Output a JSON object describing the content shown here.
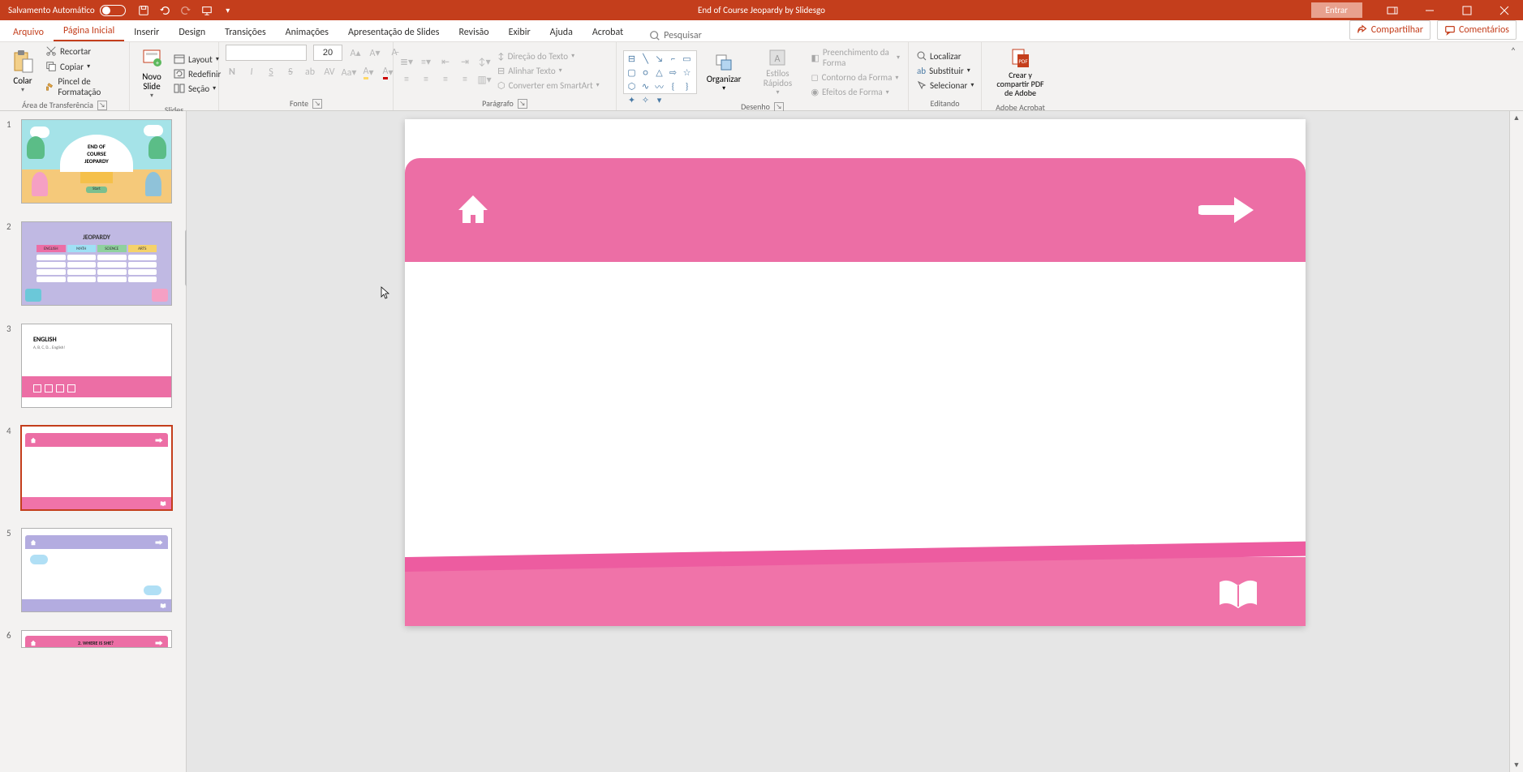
{
  "titlebar": {
    "auto_save_label": "Salvamento Automático",
    "document_title": "End of Course Jeopardy by Slidesgo",
    "sign_in": "Entrar"
  },
  "tabs": {
    "file": "Arquivo",
    "home": "Página Inicial",
    "insert": "Inserir",
    "design": "Design",
    "transitions": "Transições",
    "animations": "Animações",
    "slideshow": "Apresentação de Slides",
    "review": "Revisão",
    "view": "Exibir",
    "help": "Ajuda",
    "acrobat": "Acrobat",
    "search_placeholder": "Pesquisar",
    "share": "Compartilhar",
    "comments": "Comentários"
  },
  "ribbon": {
    "clipboard": {
      "paste": "Colar",
      "cut": "Recortar",
      "copy": "Copiar",
      "format_painter": "Pincel de Formatação",
      "group_label": "Área de Transferência"
    },
    "slides": {
      "new_slide": "Novo Slide",
      "layout": "Layout",
      "reset": "Redefinir",
      "section": "Seção",
      "group_label": "Slides"
    },
    "font": {
      "size_value": "20",
      "group_label": "Fonte"
    },
    "paragraph": {
      "text_direction": "Direção do Texto",
      "align_text": "Alinhar Texto",
      "convert_smartart": "Converter em SmartArt",
      "group_label": "Parágrafo"
    },
    "drawing": {
      "arrange": "Organizar",
      "quick_styles": "Estilos Rápidos",
      "shape_fill": "Preenchimento da Forma",
      "shape_outline": "Contorno da Forma",
      "shape_effects": "Efeitos de Forma",
      "group_label": "Desenho"
    },
    "editing": {
      "find": "Localizar",
      "replace": "Substituir",
      "select": "Selecionar",
      "group_label": "Editando"
    },
    "adobe": {
      "create_share": "Crear y compartir PDF de Adobe",
      "group_label": "Adobe Acrobat"
    }
  },
  "slides_panel": {
    "items": [
      {
        "num": "1",
        "title_line1": "END OF",
        "title_line2": "COURSE",
        "title_line3": "JEOPARDY",
        "start_btn": "Start"
      },
      {
        "num": "2",
        "header": "JEOPARDY",
        "cat1": "ENGLISH",
        "cat2": "MATH",
        "cat3": "SCIENCE",
        "cat4": "ARTS"
      },
      {
        "num": "3",
        "label": "ENGLISH",
        "sub": "A, B, C, D… English!"
      },
      {
        "num": "4"
      },
      {
        "num": "5"
      },
      {
        "num": "6",
        "question": "2. WHERE IS SHE?"
      }
    ]
  },
  "chart_data": null
}
